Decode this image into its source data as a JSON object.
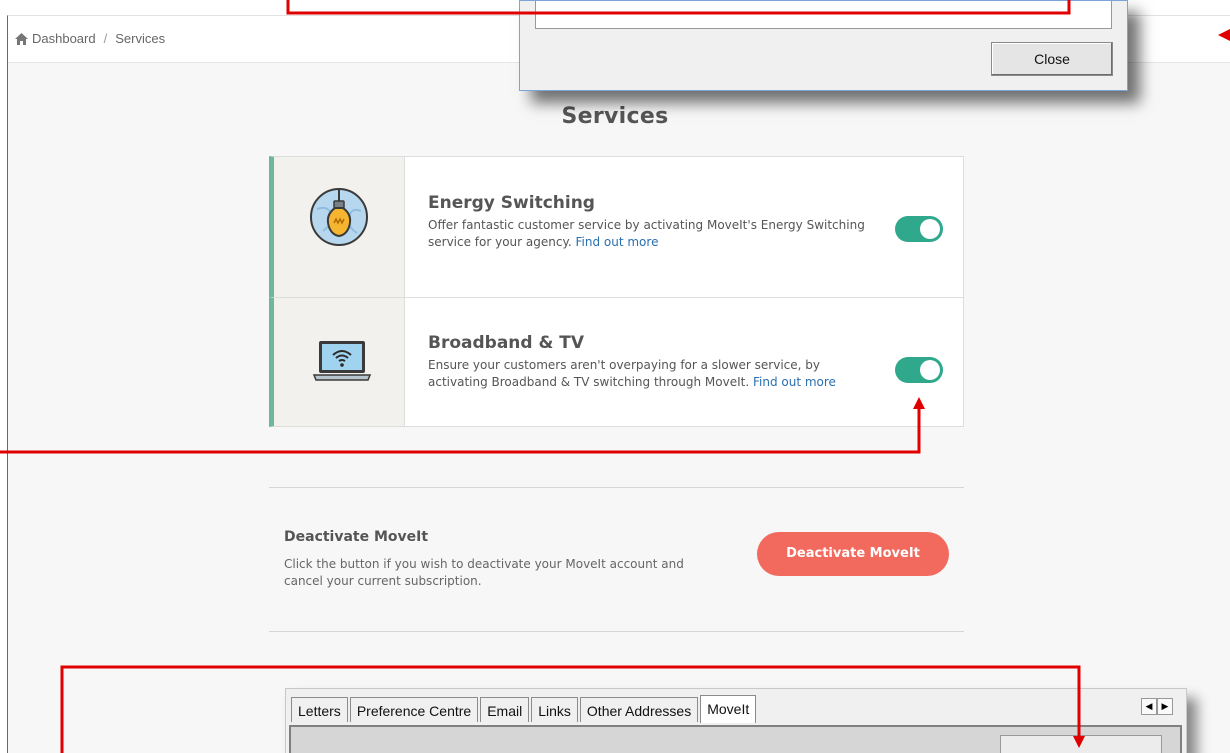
{
  "breadcrumb": {
    "home": "Dashboard",
    "separator": "/",
    "current": "Services"
  },
  "page_title": "Services",
  "services": [
    {
      "title": "Energy Switching",
      "description": "Offer fantastic customer service by activating MoveIt's Energy Switching service for your agency.",
      "link": "Find out more",
      "icon": "lightbulb-icon",
      "enabled": true
    },
    {
      "title": "Broadband & TV",
      "description": "Ensure your customers aren't overpaying for a slower service, by activating Broadband & TV switching through MoveIt.",
      "link": "Find out more",
      "icon": "laptop-wifi-icon",
      "enabled": true
    }
  ],
  "deactivate": {
    "title": "Deactivate MoveIt",
    "description": "Click the button if you wish to deactivate your MoveIt account and cancel your current subscription.",
    "button": "Deactivate MoveIt"
  },
  "dialog": {
    "close_label": "Close"
  },
  "desktop_tabs": {
    "items": [
      "Letters",
      "Preference Centre",
      "Email",
      "Links",
      "Other Addresses",
      "MoveIt"
    ],
    "active": "MoveIt",
    "scroll_left": "◀",
    "scroll_right": "▶"
  },
  "colors": {
    "toggle_on": "#2fa88c",
    "accent_bar": "#6db89a",
    "deactivate": "#f26a5e",
    "annotation": "#e00000",
    "link": "#2a6fb0"
  }
}
